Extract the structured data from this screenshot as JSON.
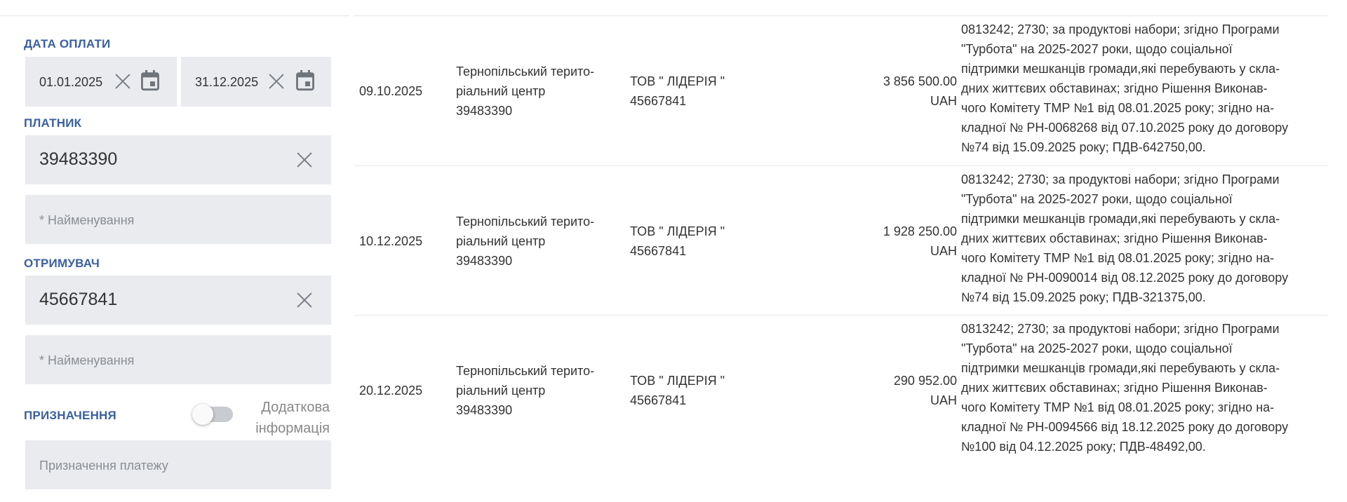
{
  "filters": {
    "payment_date": {
      "label": "ДАТА ОПЛАТИ",
      "from": "01.01.2025",
      "to": "31.12.2025"
    },
    "payer": {
      "label": "ПЛАТНИК",
      "code": "39483390",
      "name_placeholder": "* Найменування"
    },
    "recipient": {
      "label": "ОТРИМУВАЧ",
      "code": "45667841",
      "name_placeholder": "* Найменування"
    },
    "purpose": {
      "label": "ПРИЗНАЧЕННЯ",
      "toggle_label_1": "Додаткова",
      "toggle_label_2": "інформація",
      "toggle_on": false,
      "placeholder": "Призначення платежу"
    }
  },
  "rows": [
    {
      "date": "09.10.2025",
      "payer_line1": "Тернопільський терито-",
      "payer_line2": "ріальний центр",
      "payer_line3": "39483390",
      "recipient_line1": "ТОВ \" ЛІДЕРІЯ \"",
      "recipient_line2": "45667841",
      "amount": "3 856 500.00",
      "currency": "UAH",
      "purpose": [
        "0813242; 2730; за продуктові набори; згідно Програми",
        "\"Турбота\" на 2025-2027 роки, щодо соціальної",
        "підтримки мешканців громади,які перебувають у скла-",
        "дних життєвих обставинах; згідно Рішення Виконав-",
        "чого Комітету ТМР №1 від 08.01.2025 року; згідно на-",
        "кладної № РН-0068268 від 07.10.2025 року до договору",
        "№74 від 15.09.2025 року; ПДВ-642750,00."
      ]
    },
    {
      "date": "10.12.2025",
      "payer_line1": "Тернопільський терито-",
      "payer_line2": "ріальний центр",
      "payer_line3": "39483390",
      "recipient_line1": "ТОВ \" ЛІДЕРІЯ \"",
      "recipient_line2": "45667841",
      "amount": "1 928 250.00",
      "currency": "UAH",
      "purpose": [
        "0813242; 2730; за продуктові набори; згідно Програми",
        "\"Турбота\" на 2025-2027 роки, щодо соціальної",
        "підтримки мешканців громади,які перебувають у скла-",
        "дних життєвих обставинах; згідно Рішення Виконав-",
        "чого Комітету ТМР №1 від 08.01.2025 року; згідно на-",
        "кладної № РН-0090014 від 08.12.2025 року до договору",
        "№74 від 15.09.2025 року; ПДВ-321375,00."
      ]
    },
    {
      "date": "20.12.2025",
      "payer_line1": "Тернопільський терито-",
      "payer_line2": "ріальний центр",
      "payer_line3": "39483390",
      "recipient_line1": "ТОВ \" ЛІДЕРІЯ \"",
      "recipient_line2": "45667841",
      "amount": "290 952.00",
      "currency": "UAH",
      "purpose": [
        "0813242; 2730; за продуктові набори; згідно Програми",
        "\"Турбота\" на 2025-2027 роки, щодо соціальної",
        "підтримки мешканців громади,які перебувають у скла-",
        "дних життєвих обставинах; згідно Рішення Виконав-",
        "чого Комітету ТМР №1 від 08.01.2025 року; згідно на-",
        "кладної № РН-0094566 від 18.12.2025 року до договору",
        "№100 від 04.12.2025 року; ПДВ-48492,00."
      ]
    }
  ]
}
